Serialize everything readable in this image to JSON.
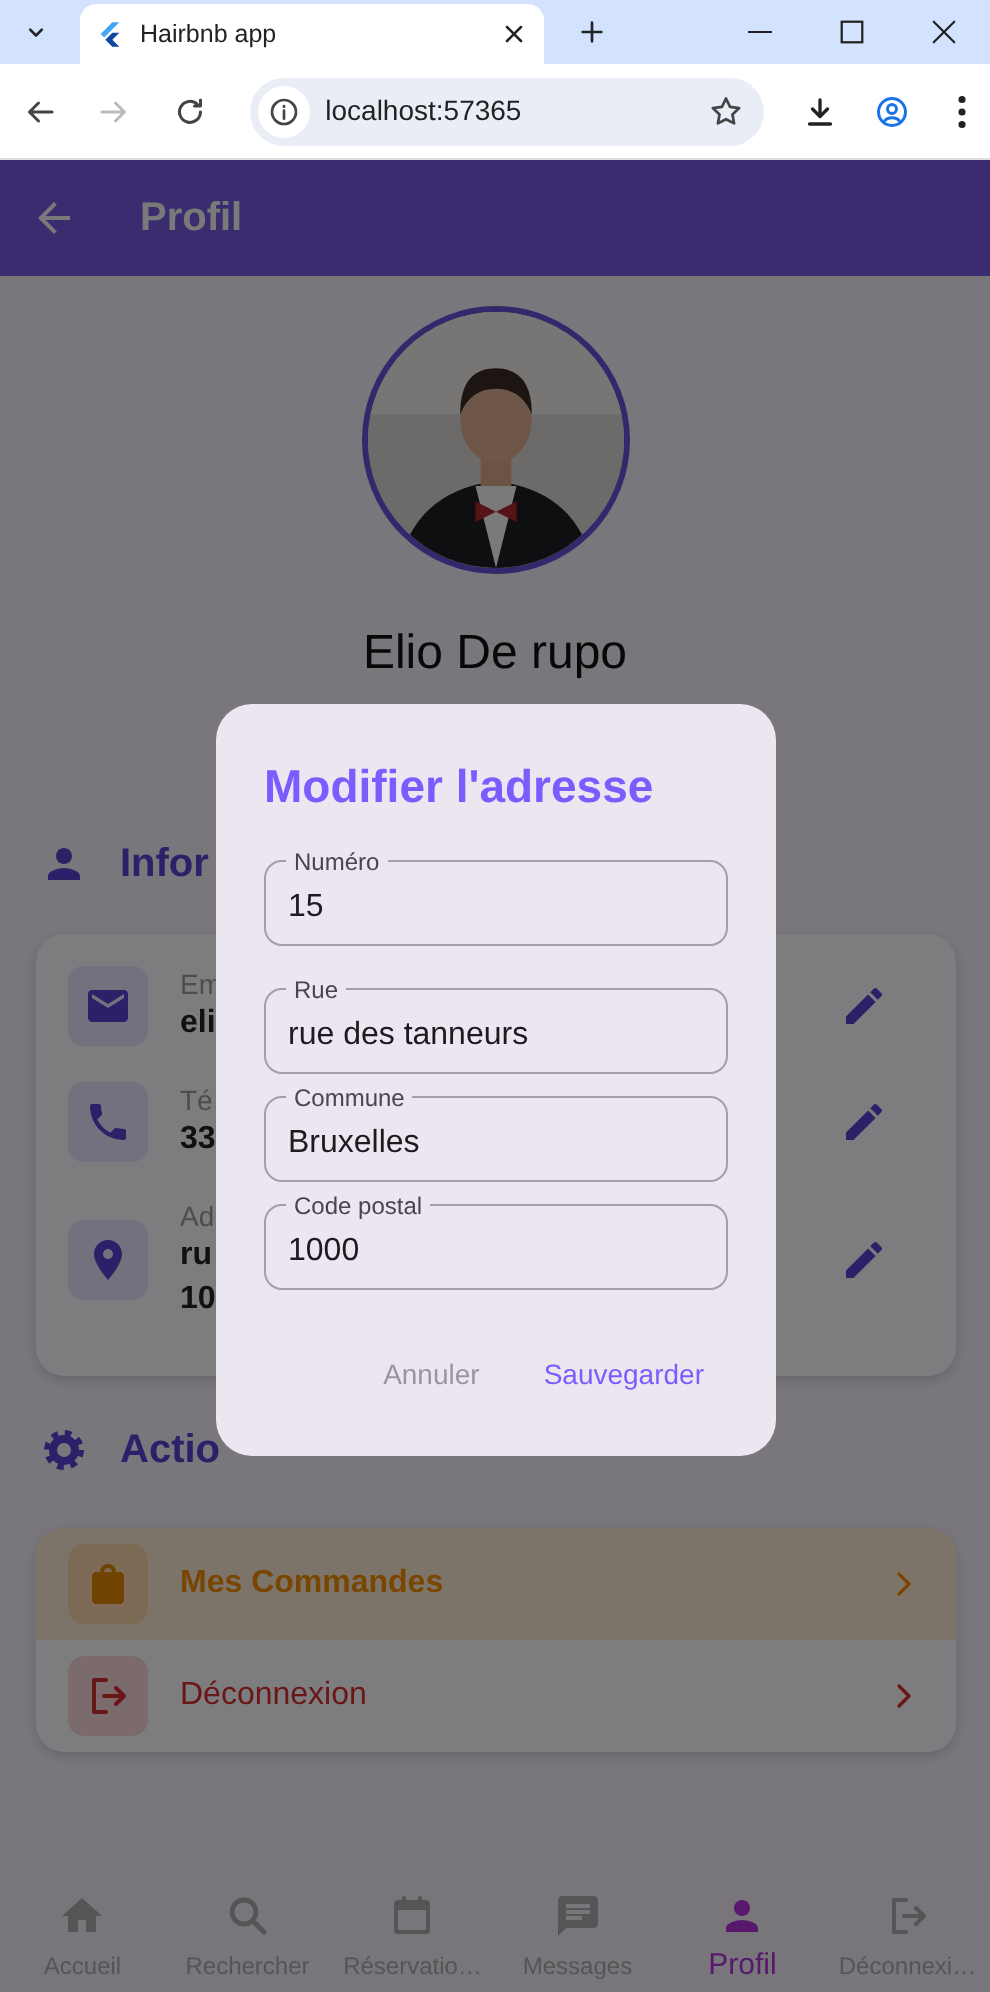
{
  "browser": {
    "tab_title": "Hairbnb app",
    "address": "localhost:57365"
  },
  "app_bar": {
    "title": "Profil"
  },
  "profile": {
    "name": "Elio De rupo"
  },
  "info_section": {
    "title": "Infor",
    "rows": [
      {
        "kind": "email",
        "label": "Em",
        "value_lines": [
          "eli"
        ]
      },
      {
        "kind": "phone",
        "label": "Té",
        "value_lines": [
          "33"
        ]
      },
      {
        "kind": "address",
        "label": "Ad",
        "value_lines": [
          "ru",
          "10"
        ]
      }
    ]
  },
  "actions_section": {
    "title": "Actio",
    "items": [
      {
        "kind": "orders",
        "label": "Mes Commandes"
      },
      {
        "kind": "logout",
        "label": "Déconnexion"
      }
    ]
  },
  "dialog": {
    "title": "Modifier l'adresse",
    "fields": [
      {
        "label": "Numéro",
        "value": "15"
      },
      {
        "label": "Rue",
        "value": "rue des tanneurs"
      },
      {
        "label": "Commune",
        "value": "Bruxelles"
      },
      {
        "label": "Code postal",
        "value": "1000"
      }
    ],
    "buttons": [
      {
        "kind": "cancel",
        "label": "Annuler"
      },
      {
        "kind": "save",
        "label": "Sauvegarder"
      }
    ]
  },
  "bottom_nav": [
    {
      "kind": "home",
      "label": "Accueil",
      "selected": false
    },
    {
      "kind": "search",
      "label": "Rechercher",
      "selected": false
    },
    {
      "kind": "calendar",
      "label": "Réservatio…",
      "selected": false
    },
    {
      "kind": "messages",
      "label": "Messages",
      "selected": false
    },
    {
      "kind": "person",
      "label": "Profil",
      "selected": true
    },
    {
      "kind": "logout",
      "label": "Déconnexi…",
      "selected": false
    }
  ]
}
